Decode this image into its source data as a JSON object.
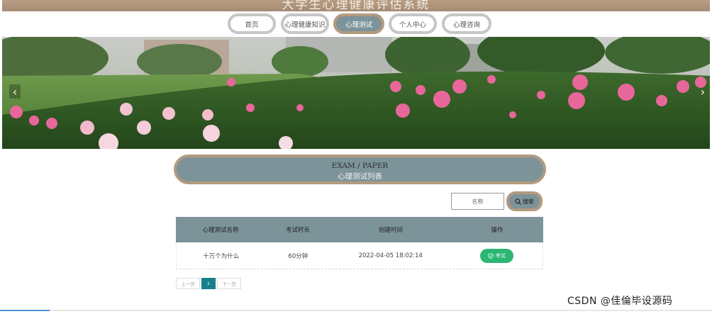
{
  "site": {
    "title": "大学生心理健康评估系统"
  },
  "nav": {
    "items": [
      {
        "label": "首页"
      },
      {
        "label": "心理健康知识"
      },
      {
        "label": "心理测试"
      },
      {
        "label": "个人中心"
      },
      {
        "label": "心理咨询"
      }
    ],
    "active_index": 2
  },
  "banner": {
    "prev_glyph": "‹",
    "next_glyph": "›"
  },
  "section": {
    "title_en": "EXAM / PAPER",
    "title_cn": "心理测试列表"
  },
  "search": {
    "placeholder": "名称",
    "button_label": "搜索"
  },
  "table": {
    "headers": [
      "心理测试名称",
      "考试时长",
      "创建时间",
      "操作"
    ],
    "rows": [
      {
        "name": "十万个为什么",
        "duration": "60分钟",
        "created": "2022-04-05 18:02:14",
        "action": "考试"
      }
    ]
  },
  "pagination": {
    "prev": "上一页",
    "current": "1",
    "next": "下一页"
  },
  "watermark": "CSDN @佳倫毕设源码",
  "colors": {
    "accent": "#7d939a",
    "border_brown": "#b39a7e",
    "action_green": "#2bb673",
    "page_active": "#17808a"
  }
}
